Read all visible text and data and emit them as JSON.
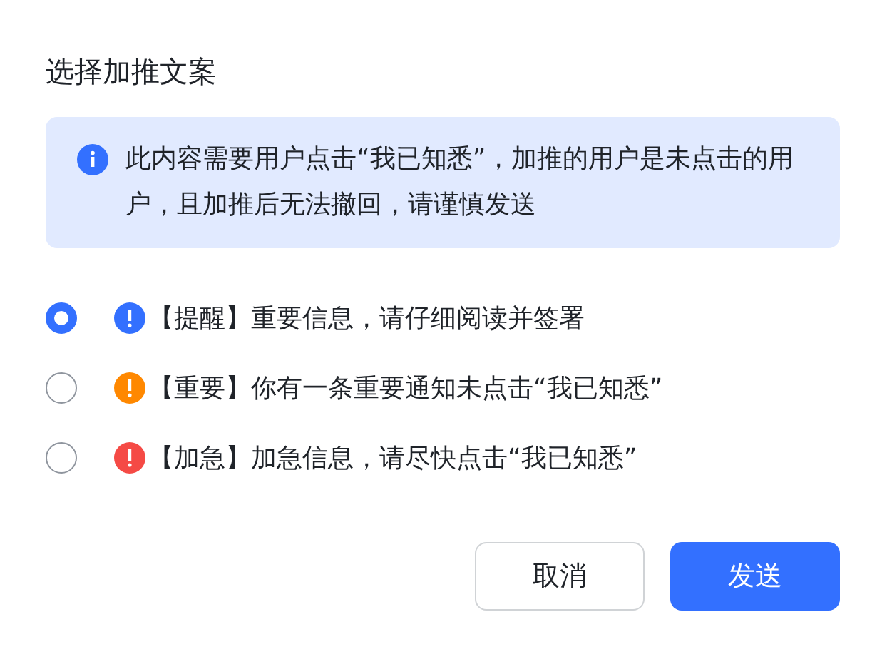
{
  "dialog": {
    "title": "选择加推文案",
    "notice": {
      "text": "此内容需要用户点击“我已知悉”，加推的用户是未点击的用户，且加推后无法撤回，请谨慎发送"
    },
    "options": [
      {
        "label": "【提醒】重要信息，请仔细阅读并签署",
        "selected": true,
        "color": "#3370ff"
      },
      {
        "label": "【重要】你有一条重要通知未点击“我已知悉”",
        "selected": false,
        "color": "#ff8800"
      },
      {
        "label": "【加急】加急信息，请尽快点击“我已知悉”",
        "selected": false,
        "color": "#f54a45"
      }
    ],
    "buttons": [
      {
        "label": "取消",
        "kind": "secondary"
      },
      {
        "label": "发送",
        "kind": "primary"
      }
    ]
  }
}
